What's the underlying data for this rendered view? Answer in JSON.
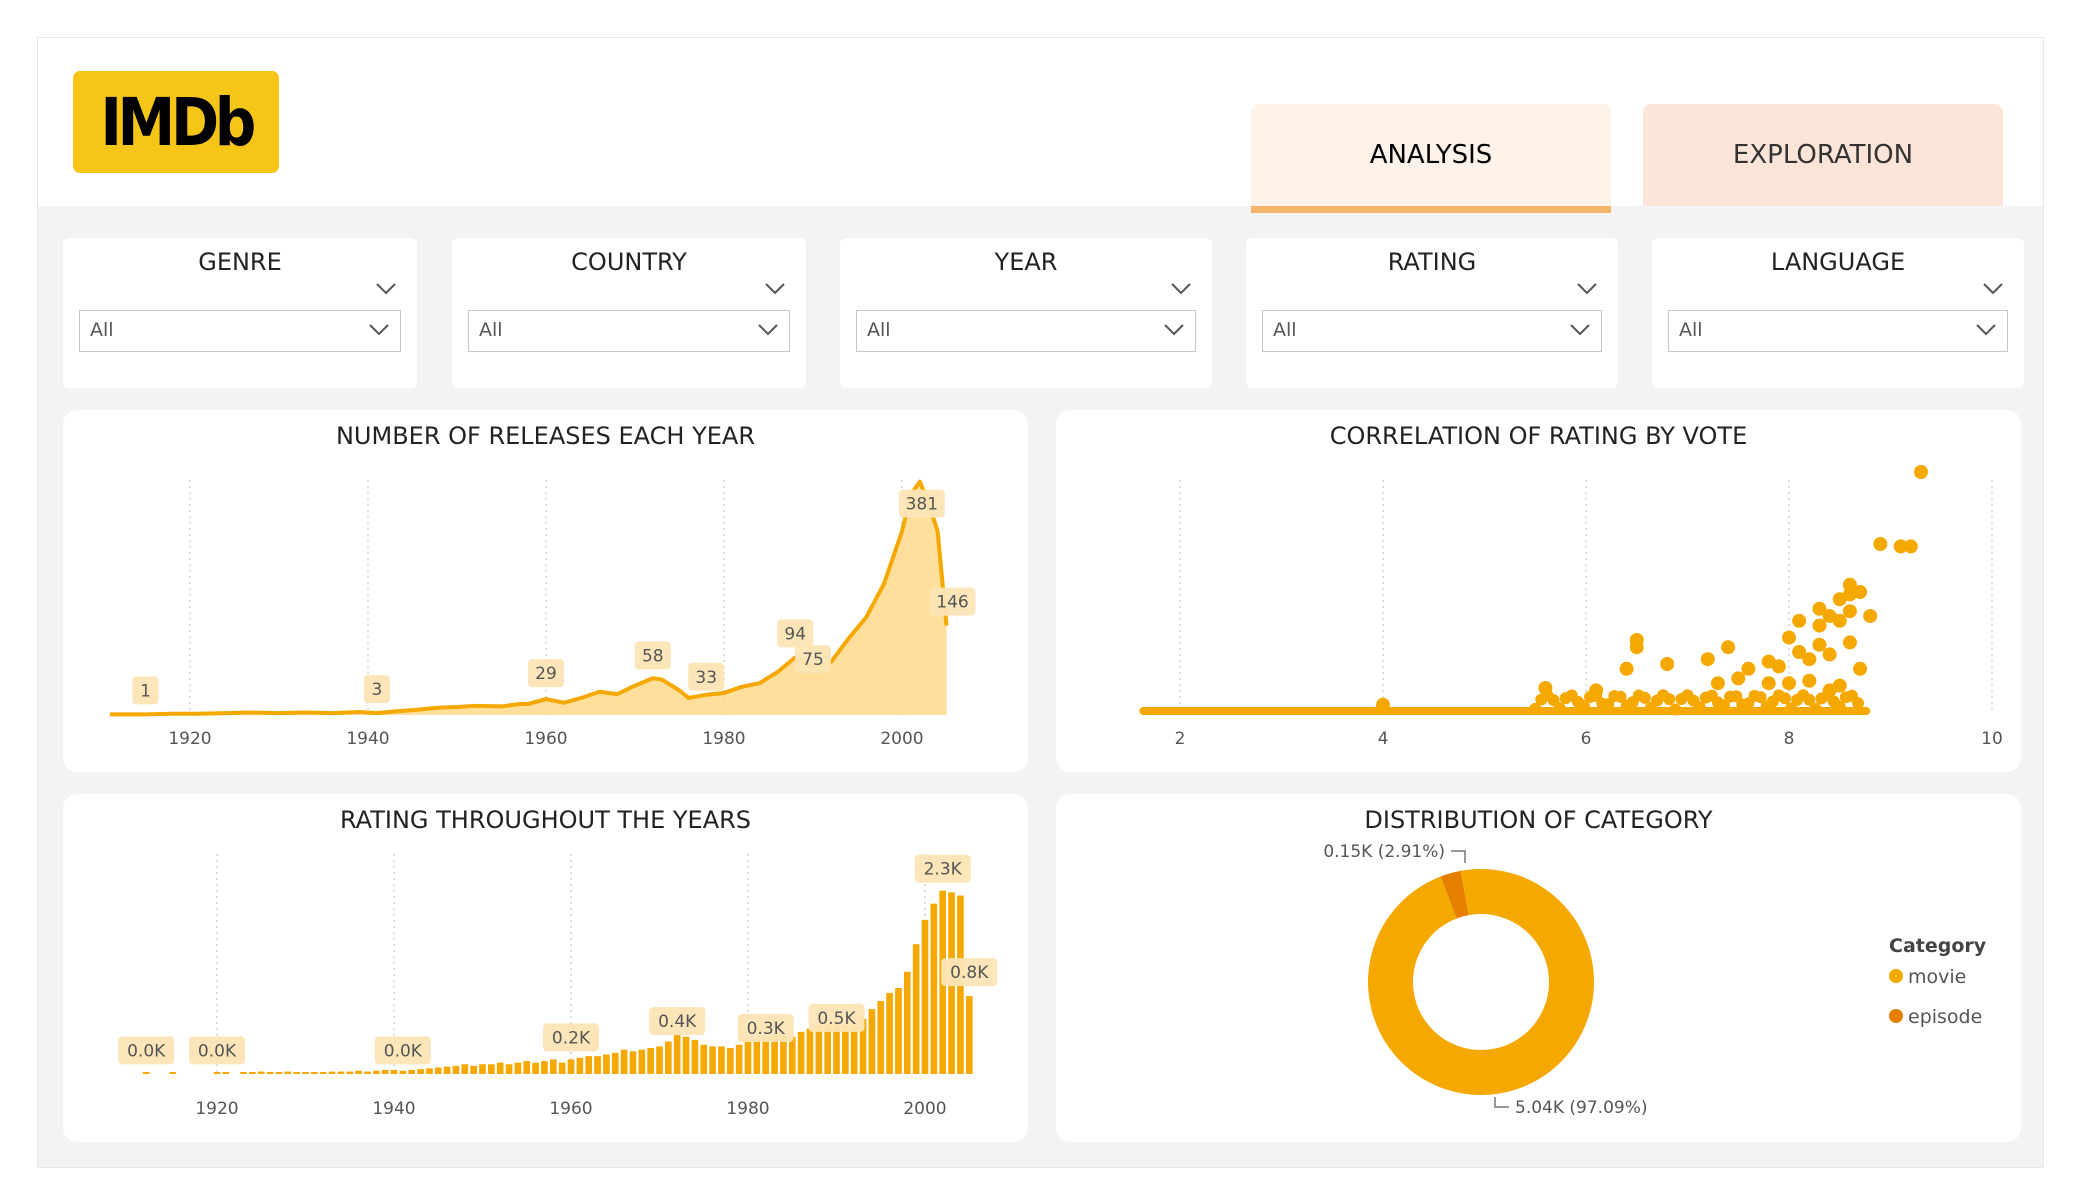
{
  "header": {
    "logo_text": "IMDb",
    "tabs": [
      {
        "label": "ANALYSIS",
        "active": true
      },
      {
        "label": "EXPLORATION",
        "active": false
      }
    ]
  },
  "filters": [
    {
      "title": "GENRE",
      "value": "All"
    },
    {
      "title": "COUNTRY",
      "value": "All"
    },
    {
      "title": "YEAR",
      "value": "All"
    },
    {
      "title": "RATING",
      "value": "All"
    },
    {
      "title": "LANGUAGE",
      "value": "All"
    }
  ],
  "colors": {
    "accent": "#f5a800",
    "area_fill": "#ffd98a",
    "label_bg": "#fce5b5",
    "episode": "#e67e00",
    "logo": "#f5c518"
  },
  "chart_data": [
    {
      "id": "releases",
      "type": "area",
      "title": "NUMBER OF RELEASES EACH YEAR",
      "xlim": [
        1915,
        2006
      ],
      "ylim": [
        0,
        400
      ],
      "x_ticks": [
        1920,
        1940,
        1960,
        1980,
        2000
      ],
      "x": [
        1911,
        1915,
        1918,
        1921,
        1924,
        1927,
        1930,
        1933,
        1936,
        1939,
        1941,
        1943,
        1945,
        1948,
        1950,
        1952,
        1955,
        1957,
        1958,
        1960,
        1962,
        1964,
        1966,
        1968,
        1970,
        1972,
        1973,
        1975,
        1976,
        1978,
        1980,
        1982,
        1984,
        1986,
        1988,
        1990,
        1992,
        1994,
        1996,
        1998,
        2000,
        2001,
        2002,
        2003,
        2004,
        2005
      ],
      "values": [
        1,
        1,
        2,
        2,
        3,
        4,
        3,
        4,
        3,
        5,
        3,
        6,
        8,
        12,
        13,
        15,
        14,
        18,
        18,
        26,
        20,
        28,
        38,
        34,
        48,
        60,
        58,
        40,
        28,
        33,
        36,
        46,
        52,
        70,
        94,
        78,
        86,
        125,
        160,
        215,
        300,
        360,
        381,
        345,
        300,
        146
      ],
      "labels": [
        {
          "x": 1915,
          "y": 1,
          "text": "1"
        },
        {
          "x": 1941,
          "y": 3,
          "text": "3"
        },
        {
          "x": 1960,
          "y": 29,
          "text": "29"
        },
        {
          "x": 1972,
          "y": 58,
          "text": "58"
        },
        {
          "x": 1978,
          "y": 33,
          "text": "33"
        },
        {
          "x": 1988,
          "y": 94,
          "text": "94"
        },
        {
          "x": 1990,
          "y": 75,
          "text": "75"
        },
        {
          "x": 2002,
          "y": 381,
          "text": "381"
        },
        {
          "x": 2005,
          "y": 146,
          "text": "146"
        }
      ]
    },
    {
      "id": "correlation",
      "type": "scatter",
      "title": "CORRELATION OF RATING BY VOTE",
      "xlim": [
        1.0,
        10.0
      ],
      "x_ticks": [
        2,
        4,
        6,
        8,
        10
      ],
      "points": [
        [
          9.3,
          1.0
        ],
        [
          8.9,
          0.7
        ],
        [
          9.1,
          0.69
        ],
        [
          9.2,
          0.69
        ],
        [
          8.6,
          0.53
        ],
        [
          8.5,
          0.47
        ],
        [
          8.6,
          0.49
        ],
        [
          8.7,
          0.5
        ],
        [
          8.3,
          0.43
        ],
        [
          8.6,
          0.42
        ],
        [
          8.8,
          0.4
        ],
        [
          8.1,
          0.38
        ],
        [
          8.5,
          0.38
        ],
        [
          8.4,
          0.4
        ],
        [
          8.3,
          0.36
        ],
        [
          6.5,
          0.3
        ],
        [
          6.5,
          0.27
        ],
        [
          8.0,
          0.31
        ],
        [
          8.6,
          0.29
        ],
        [
          8.3,
          0.28
        ],
        [
          7.4,
          0.27
        ],
        [
          7.2,
          0.22
        ],
        [
          8.2,
          0.22
        ],
        [
          8.4,
          0.24
        ],
        [
          8.1,
          0.25
        ],
        [
          7.8,
          0.21
        ],
        [
          7.9,
          0.19
        ],
        [
          6.8,
          0.2
        ],
        [
          8.7,
          0.18
        ],
        [
          6.4,
          0.18
        ],
        [
          7.6,
          0.18
        ],
        [
          5.6,
          0.1
        ],
        [
          6.1,
          0.09
        ],
        [
          7.3,
          0.12
        ],
        [
          8.0,
          0.12
        ],
        [
          8.5,
          0.11
        ],
        [
          8.2,
          0.13
        ],
        [
          7.5,
          0.14
        ],
        [
          7.8,
          0.12
        ],
        [
          8.4,
          0.09
        ],
        [
          4.0,
          0.03
        ]
      ],
      "baseline_dense": [
        1.6,
        8.8
      ]
    },
    {
      "id": "rating_years",
      "type": "bar",
      "title": "RATING THROUGHOUT THE YEARS",
      "xlim": [
        1909,
        2006
      ],
      "ylim": [
        0,
        2.6
      ],
      "x_ticks": [
        1920,
        1940,
        1960,
        1980,
        2000
      ],
      "x": [
        1912,
        1913,
        1914,
        1915,
        1916,
        1917,
        1918,
        1919,
        1920,
        1921,
        1922,
        1923,
        1924,
        1925,
        1926,
        1927,
        1928,
        1929,
        1930,
        1931,
        1932,
        1933,
        1934,
        1935,
        1936,
        1937,
        1938,
        1939,
        1940,
        1941,
        1942,
        1943,
        1944,
        1945,
        1946,
        1947,
        1948,
        1949,
        1950,
        1951,
        1952,
        1953,
        1954,
        1955,
        1956,
        1957,
        1958,
        1959,
        1960,
        1961,
        1962,
        1963,
        1964,
        1965,
        1966,
        1967,
        1968,
        1969,
        1970,
        1971,
        1972,
        1973,
        1974,
        1975,
        1976,
        1977,
        1978,
        1979,
        1980,
        1981,
        1982,
        1983,
        1984,
        1985,
        1986,
        1987,
        1988,
        1989,
        1990,
        1991,
        1992,
        1993,
        1994,
        1995,
        1996,
        1997,
        1998,
        1999,
        2000,
        2001,
        2002,
        2003,
        2004,
        2005
      ],
      "values": [
        0.02,
        0,
        0,
        0.02,
        0,
        0,
        0,
        0,
        0.02,
        0.02,
        0,
        0.02,
        0.02,
        0.03,
        0.02,
        0.02,
        0.03,
        0.02,
        0.02,
        0.02,
        0.02,
        0.03,
        0.03,
        0.03,
        0.04,
        0.03,
        0.04,
        0.05,
        0.05,
        0.04,
        0.05,
        0.06,
        0.07,
        0.08,
        0.09,
        0.1,
        0.12,
        0.1,
        0.12,
        0.12,
        0.14,
        0.12,
        0.14,
        0.16,
        0.14,
        0.16,
        0.18,
        0.14,
        0.18,
        0.2,
        0.22,
        0.22,
        0.24,
        0.26,
        0.3,
        0.28,
        0.3,
        0.32,
        0.34,
        0.4,
        0.48,
        0.46,
        0.42,
        0.36,
        0.34,
        0.34,
        0.32,
        0.36,
        0.42,
        0.44,
        0.46,
        0.5,
        0.48,
        0.46,
        0.52,
        0.56,
        0.6,
        0.62,
        0.66,
        0.6,
        0.62,
        0.68,
        0.8,
        0.9,
        1.0,
        1.06,
        1.26,
        1.6,
        1.9,
        2.1,
        2.26,
        2.24,
        2.2,
        0.96
      ],
      "labels": [
        {
          "x": 1912,
          "y": 0.02,
          "text": "0.0K"
        },
        {
          "x": 1920,
          "y": 0.02,
          "text": "0.0K"
        },
        {
          "x": 1941,
          "y": 0.02,
          "text": "0.0K"
        },
        {
          "x": 1960,
          "y": 0.18,
          "text": "0.2K"
        },
        {
          "x": 1972,
          "y": 0.38,
          "text": "0.4K"
        },
        {
          "x": 1982,
          "y": 0.32,
          "text": "0.3K"
        },
        {
          "x": 1990,
          "y": 0.42,
          "text": "0.5K"
        },
        {
          "x": 2002,
          "y": 2.26,
          "text": "2.3K"
        },
        {
          "x": 2005,
          "y": 0.96,
          "text": "0.8K"
        }
      ]
    },
    {
      "id": "category",
      "type": "pie",
      "title": "DISTRIBUTION OF CATEGORY",
      "legend_title": "Category",
      "legend_position": "right",
      "slices": [
        {
          "name": "movie",
          "value": 97.09,
          "label": "5.04K (97.09%)",
          "color": "#f5a800"
        },
        {
          "name": "episode",
          "value": 2.91,
          "label": "0.15K (2.91%)",
          "color": "#e67e00"
        }
      ]
    }
  ]
}
